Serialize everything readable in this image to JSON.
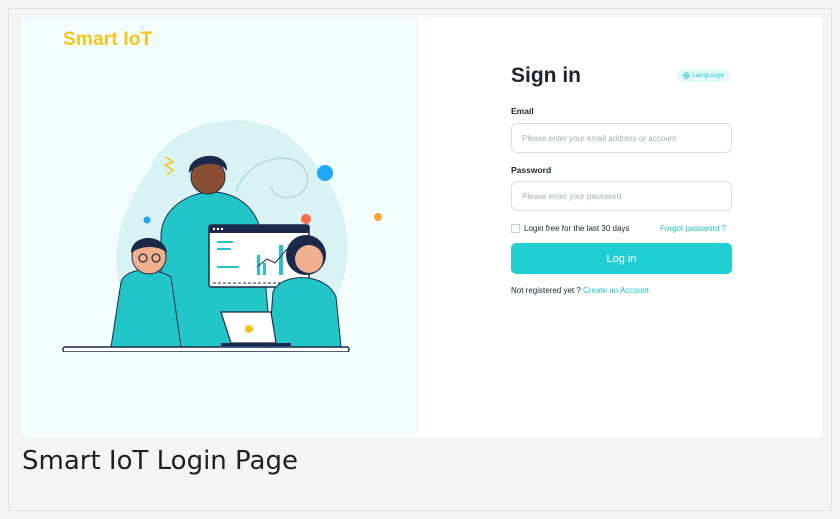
{
  "brand": {
    "name": "Smart IoT",
    "color": "#f5c518"
  },
  "login": {
    "title": "Sign in",
    "language_label": "Language",
    "email_label": "Email",
    "email_placeholder": "Please enter your email address or account",
    "password_label": "Password",
    "password_placeholder": "Please enter your password",
    "remember_label": "Login free for the last 30 days",
    "forgot_label": "Forgot password ?",
    "submit_label": "Log in",
    "register_prompt": "Not registered yet ?",
    "register_link": "Create an Account",
    "accent_color": "#1fcfd2"
  },
  "caption": "Smart IoT Login Page",
  "icons": [
    "globe-icon",
    "checkbox-icon",
    "sparkle-icon"
  ]
}
